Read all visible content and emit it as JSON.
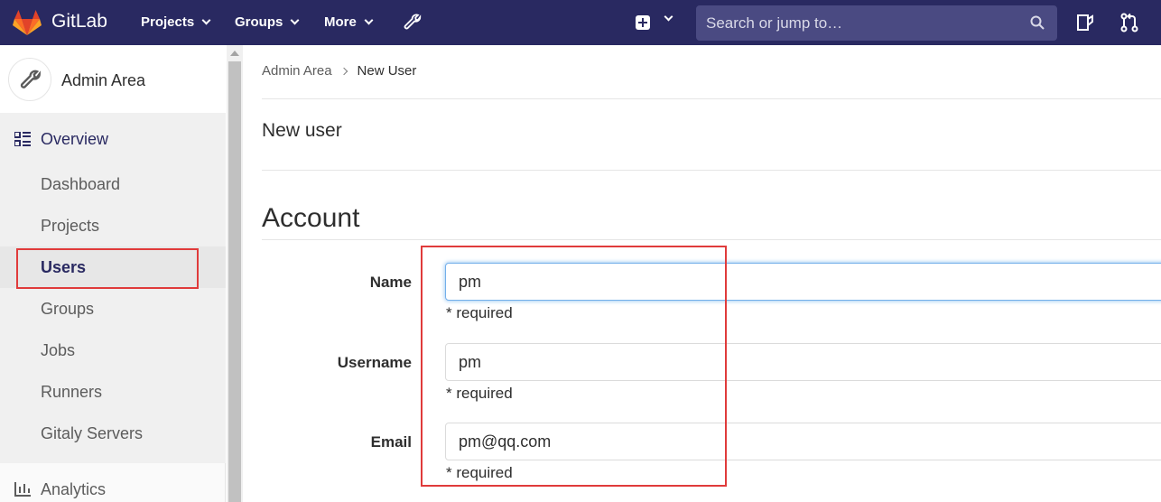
{
  "navbar": {
    "brand": "GitLab",
    "projects_label": "Projects",
    "groups_label": "Groups",
    "more_label": "More",
    "search_placeholder": "Search or jump to…",
    "bg_color": "#292961"
  },
  "sidebar": {
    "title": "Admin Area",
    "overview_label": "Overview",
    "items": [
      {
        "label": "Dashboard"
      },
      {
        "label": "Projects"
      },
      {
        "label": "Users"
      },
      {
        "label": "Groups"
      },
      {
        "label": "Jobs"
      },
      {
        "label": "Runners"
      },
      {
        "label": "Gitaly Servers"
      }
    ],
    "active_item": "Users",
    "analytics_label": "Analytics"
  },
  "breadcrumb": {
    "root": "Admin Area",
    "current": "New User"
  },
  "page": {
    "title": "New user",
    "section_title": "Account"
  },
  "form": {
    "name": {
      "label": "Name",
      "value": "pm",
      "hint": "* required"
    },
    "username": {
      "label": "Username",
      "value": "pm",
      "hint": "* required"
    },
    "email": {
      "label": "Email",
      "value": "pm@qq.com",
      "hint": "* required"
    }
  },
  "colors": {
    "highlight": "#e03b3b",
    "accent": "#292961"
  }
}
